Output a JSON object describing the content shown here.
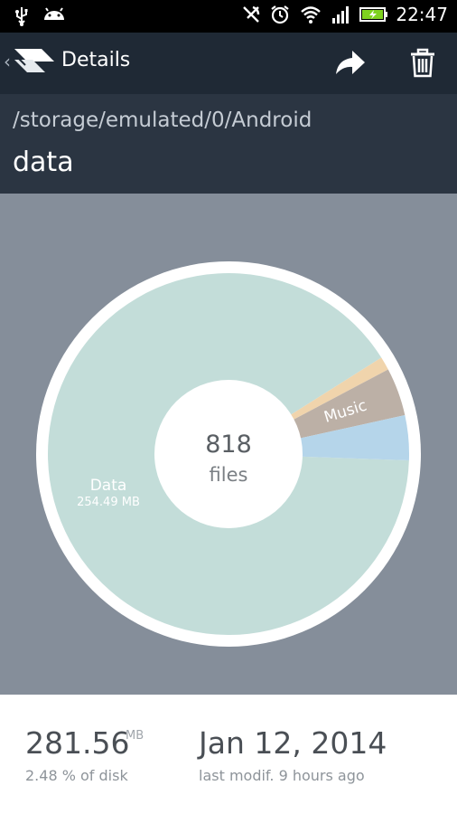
{
  "status_bar": {
    "time": "22:47",
    "icons": [
      "usb-icon",
      "android-icon",
      "alarm-muted-icon",
      "alarm-clock-icon",
      "wifi-icon",
      "signal-icon",
      "battery-charging-icon"
    ]
  },
  "app_bar": {
    "title": "Details",
    "actions": [
      {
        "icon": "share-icon"
      },
      {
        "icon": "trash-icon"
      }
    ]
  },
  "path": {
    "parent": "/storage/emulated/0/Android",
    "name": "data"
  },
  "chart": {
    "center_count": "818",
    "center_label": "files",
    "segments": [
      {
        "label": "Data",
        "sublabel": "254.49 MB",
        "color": "#c3ddd9",
        "fraction": 0.905
      },
      {
        "label": "",
        "sublabel": "",
        "color": "#f0d4ac",
        "fraction": 0.012
      },
      {
        "label": "Music",
        "sublabel": "",
        "color": "#bcb0a6",
        "fraction": 0.043
      },
      {
        "label": "",
        "sublabel": "",
        "color": "#b5d5ea",
        "fraction": 0.04
      }
    ]
  },
  "stats": {
    "size_value": "281.56",
    "size_unit": "MB",
    "size_percent": "2.48 % of disk",
    "date_value": "Jan 12, 2014",
    "date_sub": "last modif. 9 hours ago"
  }
}
